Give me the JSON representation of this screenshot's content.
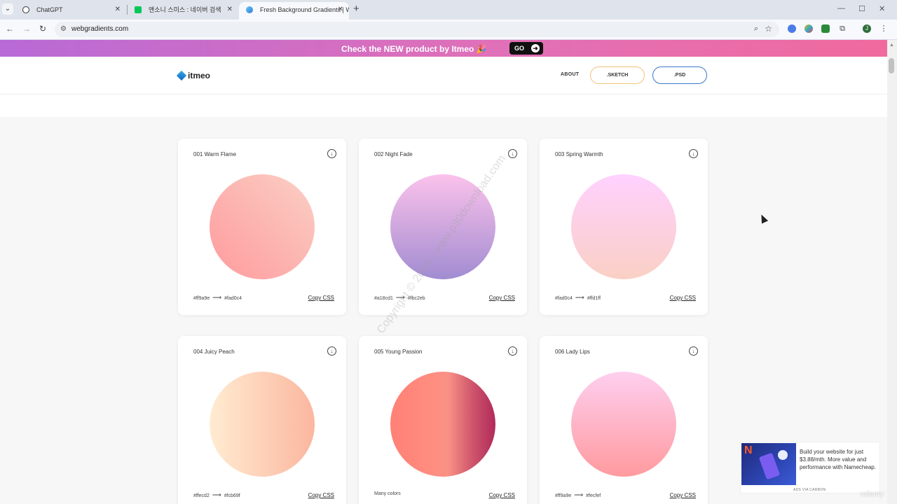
{
  "browser": {
    "tabs": [
      {
        "title": "ChatGPT",
        "favicon": "openai-icon"
      },
      {
        "title": "앤소니 스미스 : 네이버 검색",
        "favicon": "naver-icon"
      },
      {
        "title": "Fresh Background Gradients | W",
        "favicon": "webgradients-icon"
      }
    ],
    "url": "webgradients.com",
    "profile_initial": "J"
  },
  "promo": {
    "text": "Check the NEW product by Itmeo 🎉",
    "go_label": "GO"
  },
  "header": {
    "logo": "itmeo",
    "nav_about": "ABOUT",
    "sketch_label": ".SKETCH",
    "psd_label": ".PSD"
  },
  "cards": [
    {
      "title": "001 Warm Flame",
      "color_from": "#ff9a9e",
      "color_to": "#fad0c4",
      "copy": "Copy CSS"
    },
    {
      "title": "002 Night Fade",
      "color_from": "#a18cd1",
      "color_to": "#fbc2eb",
      "copy": "Copy CSS"
    },
    {
      "title": "003 Spring Warmth",
      "color_from": "#fad0c4",
      "color_to": "#ffd1ff",
      "copy": "Copy CSS"
    },
    {
      "title": "004 Juicy Peach",
      "color_from": "#ffecd2",
      "color_to": "#fcb69f",
      "copy": "Copy CSS"
    },
    {
      "title": "005 Young Passion",
      "colors_text": "Many colors",
      "copy": "Copy CSS"
    },
    {
      "title": "006 Lady Lips",
      "color_from": "#ff9a9e",
      "color_to": "#fecfef",
      "copy": "Copy CSS"
    }
  ],
  "watermark": "Copyright © 2025 - www.p30download.com",
  "ad": {
    "text": "Build your website for just $3.88/mth. More value and performance with Namecheap.",
    "via": "ADS VIA CARBON"
  },
  "overlay": "udemy"
}
